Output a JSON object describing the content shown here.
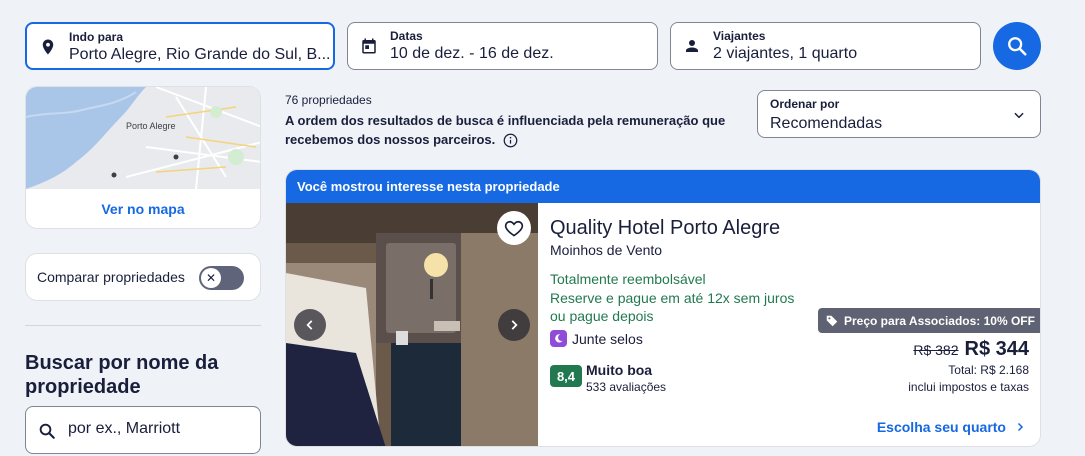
{
  "search": {
    "destination": {
      "label": "Indo para",
      "value": "Porto Alegre, Rio Grande do Sul, B..."
    },
    "dates": {
      "label": "Datas",
      "value": "10 de dez. - 16 de dez."
    },
    "travelers": {
      "label": "Viajantes",
      "value": "2 viajantes, 1 quarto"
    },
    "search_icon": "search-icon"
  },
  "sidebar": {
    "map": {
      "city_label": "Porto Alegre",
      "link": "Ver no mapa"
    },
    "compare": {
      "label": "Comparar propriedades",
      "toggle_on": false
    },
    "name_search": {
      "title": "Buscar por nome da propriedade",
      "placeholder": "por ex., Marriott"
    }
  },
  "results": {
    "count": "76 propriedades",
    "disclaimer": "A ordem dos resultados de busca é influenciada pela remuneração que recebemos dos nossos parceiros.",
    "sort": {
      "label": "Ordenar por",
      "value": "Recomendadas"
    }
  },
  "hotel": {
    "banner": "Você mostrou interesse nesta propriedade",
    "name": "Quality Hotel Porto Alegre",
    "area": "Moinhos de Vento",
    "refundable": "Totalmente reembolsável",
    "installments": "Reserve e pague em até 12x sem juros ou pague depois",
    "stamps": "Junte selos",
    "rating_score": "8,4",
    "rating_label": "Muito boa",
    "reviews": "533 avaliações",
    "member_badge": "Preço para Associados: 10% OFF",
    "old_price": "R$ 382",
    "price": "R$ 344",
    "total": "Total: R$ 2.168",
    "taxes": "inclui impostos e taxas",
    "cta": "Escolha seu quarto"
  },
  "colors": {
    "primary": "#1668e3",
    "green": "#227950",
    "background": "#eff3f7"
  }
}
